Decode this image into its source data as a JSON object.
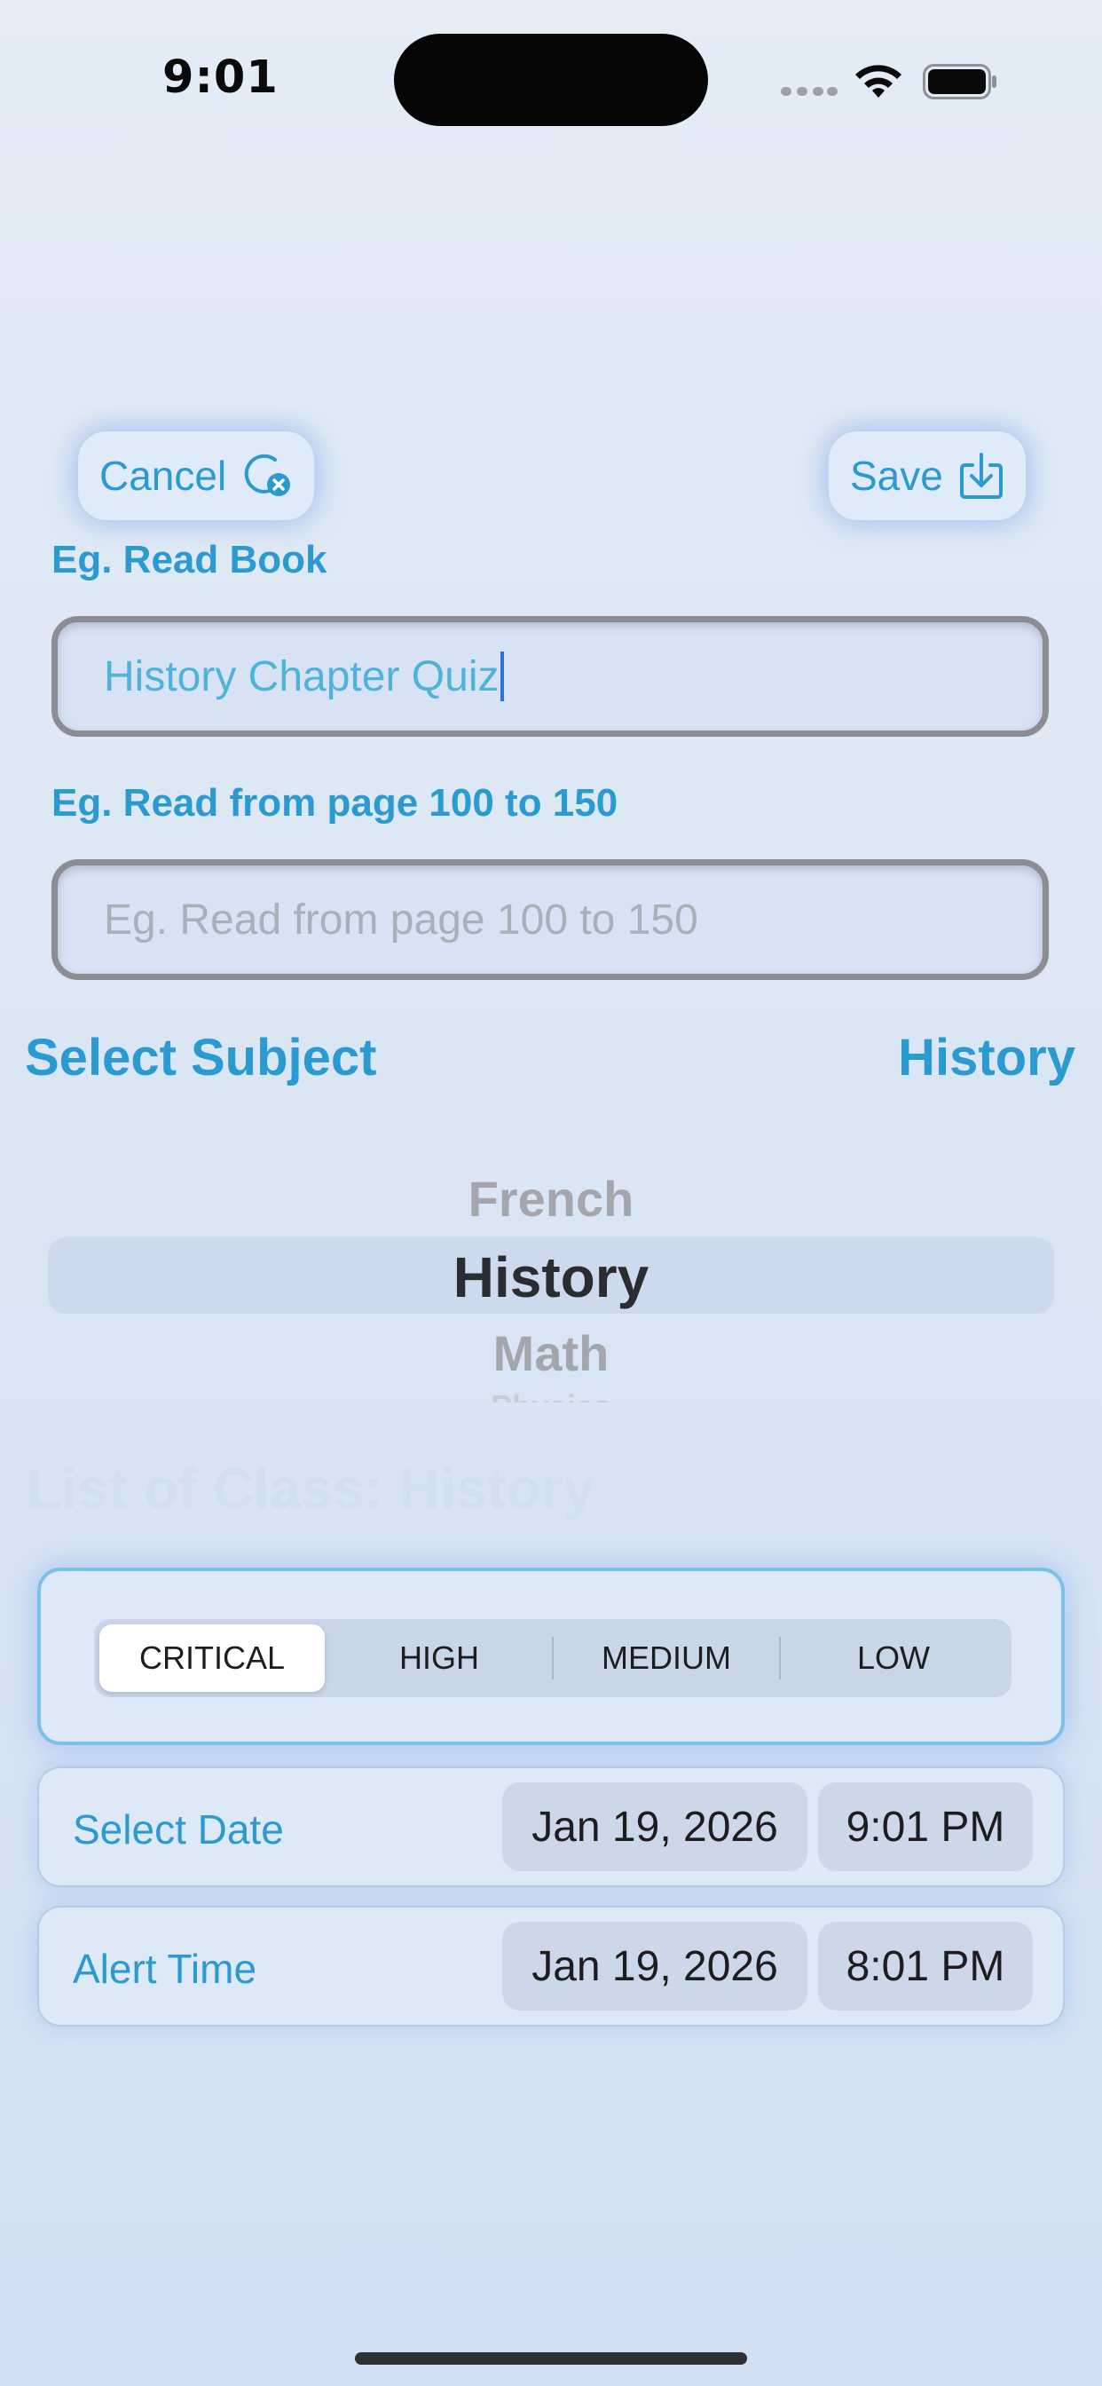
{
  "status_bar": {
    "time": "9:01"
  },
  "toolbar": {
    "cancel_label": "Cancel",
    "save_label": "Save"
  },
  "form": {
    "title_label": "Eg. Read Book",
    "title_value": "History Chapter Quiz",
    "description_label": "Eg. Read from page 100 to 150",
    "description_placeholder": "Eg. Read from page 100 to 150",
    "description_value": ""
  },
  "subject": {
    "label": "Select Subject",
    "selected": "History",
    "options_visible": [
      "French",
      "History",
      "Math",
      "Physics"
    ]
  },
  "class_heading": "List of Class: History",
  "priority": {
    "options": [
      "CRITICAL",
      "HIGH",
      "MEDIUM",
      "LOW"
    ],
    "selected": "CRITICAL"
  },
  "select_date": {
    "label": "Select Date",
    "date": "Jan 19, 2026",
    "time": "9:01 PM"
  },
  "alert_time": {
    "label": "Alert Time",
    "date": "Jan 19, 2026",
    "time": "8:01 PM"
  },
  "colors": {
    "accent": "#2b9ad1",
    "input_text": "#4fb3d9",
    "placeholder": "#a9b0ba",
    "caret": "#2f6fe0",
    "background_top": "#e3ecf7",
    "background_bottom": "#d2e0f3"
  },
  "icons": {
    "cancel": "circle-x-icon",
    "save": "download-tray-icon",
    "wifi": "wifi-icon",
    "battery": "battery-full-icon",
    "signal": "cellular-signal-icon"
  }
}
